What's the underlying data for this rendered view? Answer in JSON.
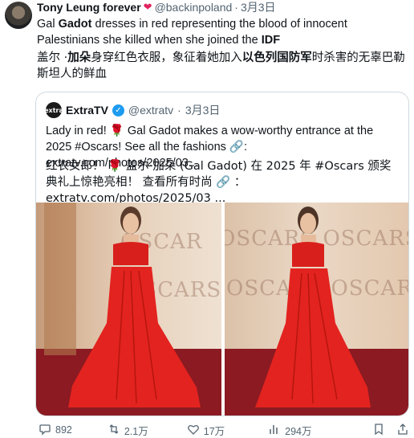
{
  "tweet": {
    "author_name": "Tony Leung forever",
    "author_handle": "@backinpoland",
    "dot": "·",
    "date": "3月3日",
    "text_en_1": "Gal ",
    "text_en_2": "Gadot",
    "text_en_3": " dresses in red representing the blood of innocent Palestinians she killed when she joined the ",
    "text_en_4": "IDF",
    "text_zh_1": "盖尔 ·",
    "text_zh_2": "加朵",
    "text_zh_3": "身穿红色衣服，象征着她加入",
    "text_zh_4": "以色列国防军",
    "text_zh_5": "时杀害的无辜巴勒斯坦人的鲜血"
  },
  "quote": {
    "avatar_text": "extra",
    "author_name": "ExtraTV",
    "author_handle": "@extratv",
    "dot": "·",
    "date": "3月3日",
    "text_en": "Lady in red! 🌹 Gal Gadot makes a wow-worthy entrance at the 2025 #Oscars! See all the fashions 🔗: extratv.com/photos/2025/03...",
    "text_zh": "红衣女郎！ 🌹 盖尔·加朵 (Gal Gadot) 在 2025 年 #Oscars 颁奖典礼上惊艳亮相！ 查看所有时尚 🔗 ： extratv.com/photos/2025/03 ..."
  },
  "photos": {
    "left_backdrop_1": "OSCAR",
    "left_backdrop_2": "OSCARS",
    "right_backdrop_1": "OSCARS OSCARS",
    "right_backdrop_2": "OSCARS OSCAR"
  },
  "actions": {
    "replies": "892",
    "retweets": "2.1万",
    "likes": "17万",
    "views": "294万"
  },
  "colors": {
    "accent": "#1d9bf0",
    "heart": "#e0245e",
    "dress": "#e3231f",
    "muted_text": "#536471"
  }
}
